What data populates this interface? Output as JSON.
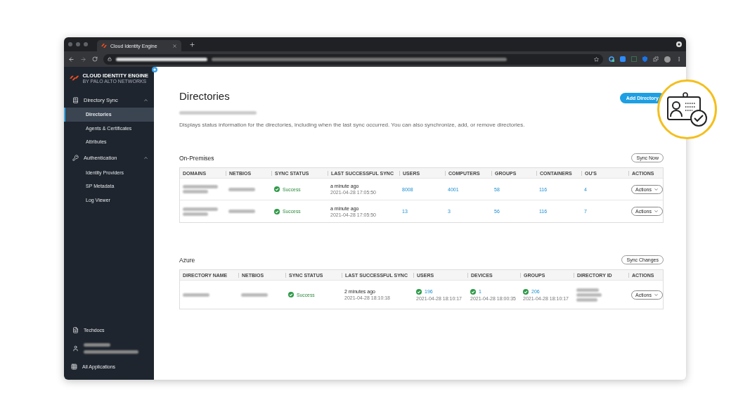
{
  "browser": {
    "tab_title": "Cloud Identity Engine"
  },
  "sidebar": {
    "brand": "CLOUD IDENTITY ENGINE",
    "brand_sub": "BY PALO ALTO NETWORKS",
    "sections": [
      {
        "label": "Directory Sync",
        "expanded": true,
        "items": [
          {
            "label": "Directories",
            "selected": true
          },
          {
            "label": "Agents & Certificates",
            "selected": false
          },
          {
            "label": "Attributes",
            "selected": false
          }
        ]
      },
      {
        "label": "Authentication",
        "expanded": true,
        "items": [
          {
            "label": "Identity Providers",
            "selected": false
          },
          {
            "label": "SP Metadata",
            "selected": false
          },
          {
            "label": "Log Viewer",
            "selected": false
          }
        ]
      }
    ],
    "docs": "Techdocs",
    "apps": "All Applications"
  },
  "page": {
    "title": "Directories",
    "description": "Displays status information for the directories, including when the last sync occurred. You can also synchronize, add, or remove directories.",
    "add_button": "Add Directory"
  },
  "tables": [
    {
      "title": "On-Premises",
      "button": "Sync Now",
      "columns": [
        "DOMAINS",
        "NETBIOS",
        "SYNC STATUS",
        "LAST SUCCESSFUL SYNC",
        "USERS",
        "COMPUTERS",
        "GROUPS",
        "CONTAINERS",
        "OU'S",
        "ACTIONS"
      ],
      "rows": [
        {
          "cells": [
            {
              "kind": "redacted"
            },
            {
              "kind": "redacted_line"
            },
            {
              "kind": "status",
              "text": "Success"
            },
            {
              "kind": "sync",
              "text": "a minute ago",
              "date": "2021-04-28 17:05:50"
            },
            {
              "kind": "link",
              "text": "8008"
            },
            {
              "kind": "link",
              "text": "4001"
            },
            {
              "kind": "link",
              "text": "58"
            },
            {
              "kind": "link",
              "text": "116"
            },
            {
              "kind": "link",
              "text": "4"
            },
            {
              "kind": "actions",
              "text": "Actions"
            }
          ]
        },
        {
          "cells": [
            {
              "kind": "redacted"
            },
            {
              "kind": "redacted_line"
            },
            {
              "kind": "status",
              "text": "Success"
            },
            {
              "kind": "sync",
              "text": "a minute ago",
              "date": "2021-04-28 17:05:50"
            },
            {
              "kind": "link",
              "text": "13"
            },
            {
              "kind": "link",
              "text": "3"
            },
            {
              "kind": "link",
              "text": "56"
            },
            {
              "kind": "link",
              "text": "116"
            },
            {
              "kind": "link",
              "text": "7"
            },
            {
              "kind": "actions",
              "text": "Actions"
            }
          ]
        }
      ]
    },
    {
      "title": "Azure",
      "button": "Sync Changes",
      "columns": [
        "DIRECTORY NAME",
        "NETBIOS",
        "SYNC STATUS",
        "LAST SUCCESSFUL SYNC",
        "USERS",
        "DEVICES",
        "GROUPS",
        "DIRECTORY ID",
        "ACTIONS"
      ],
      "rows": [
        {
          "cells": [
            {
              "kind": "redacted_line"
            },
            {
              "kind": "redacted_line"
            },
            {
              "kind": "status",
              "text": "Success"
            },
            {
              "kind": "sync",
              "text": "2 minutes ago",
              "date": "2021-04-28 18:10:18"
            },
            {
              "kind": "checked_link",
              "text": "196",
              "date": "2021-04-28 18:10:17"
            },
            {
              "kind": "checked_link",
              "text": "1",
              "date": "2021-04-28 18:00:35"
            },
            {
              "kind": "checked_link",
              "text": "206",
              "date": "2021-04-28 18:10:17"
            },
            {
              "kind": "redacted_block"
            },
            {
              "kind": "actions",
              "text": "Actions"
            }
          ]
        }
      ]
    }
  ]
}
